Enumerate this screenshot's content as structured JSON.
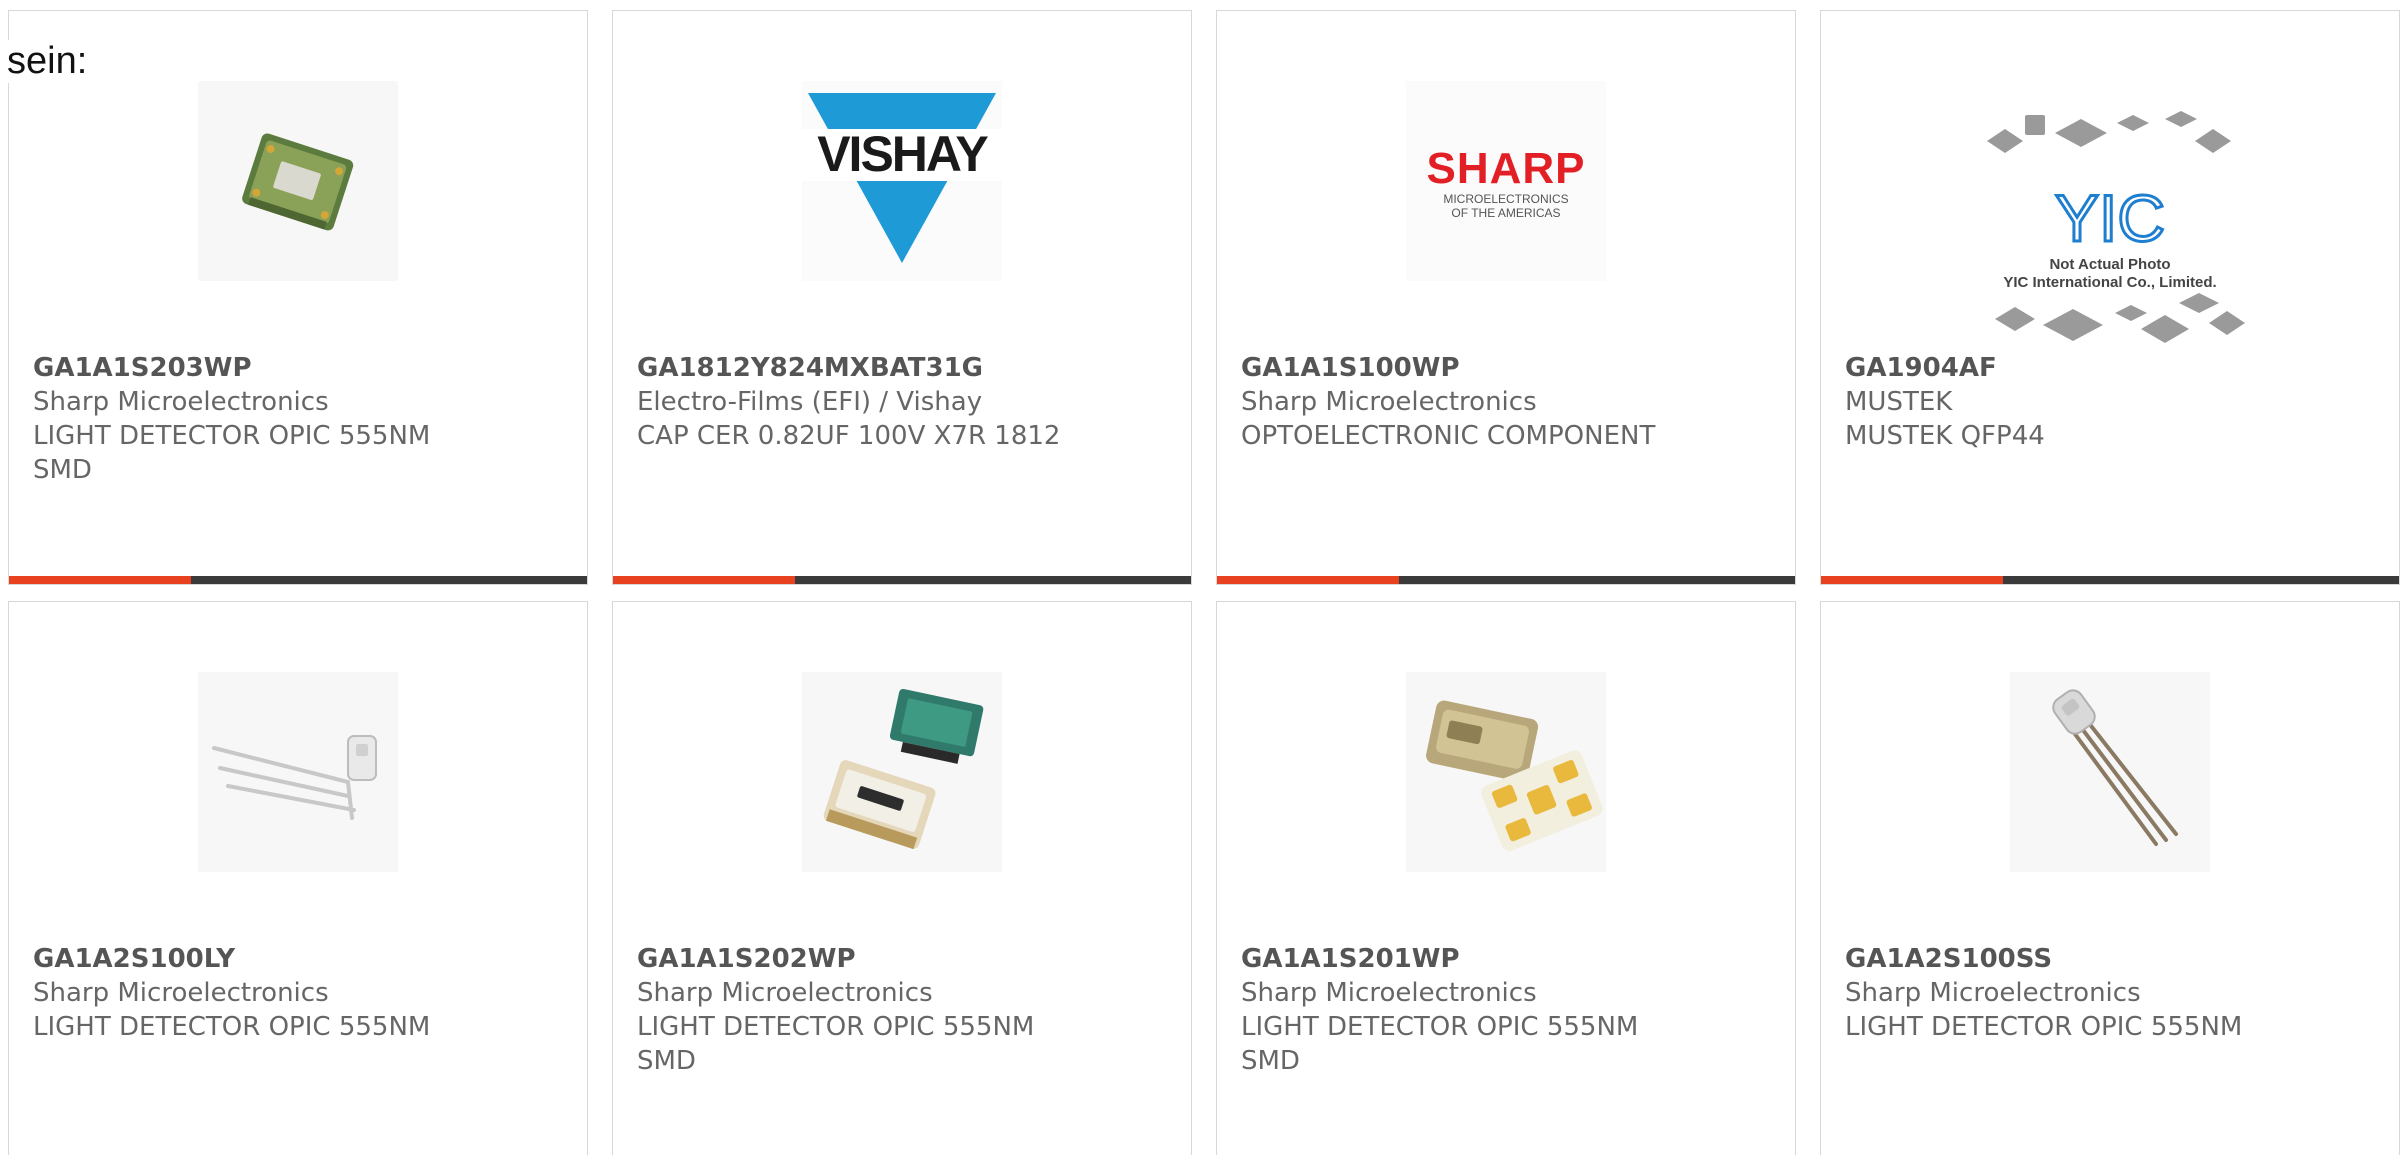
{
  "heading": "sein:",
  "colors": {
    "bar_accent": "#e8411f",
    "bar_dark": "#3a3a3a",
    "text": "#666666",
    "card_border": "#d8d8d8"
  },
  "products": [
    {
      "part_number": "GA1A1S203WP",
      "manufacturer": "Sharp Microelectronics",
      "description": [
        "LIGHT DETECTOR OPIC 555NM",
        "SMD"
      ],
      "image": "module-photo-icon",
      "has_bar": true
    },
    {
      "part_number": "GA1812Y824MXBAT31G",
      "manufacturer": "Electro-Films (EFI) / Vishay",
      "description": [
        "CAP CER 0.82UF 100V X7R 1812"
      ],
      "image": "vishay-logo",
      "logo_text": "VISHAY",
      "has_bar": true
    },
    {
      "part_number": "GA1A1S100WP",
      "manufacturer": "Sharp Microelectronics",
      "description": [
        "OPTOELECTRONIC COMPONENT"
      ],
      "image": "sharp-logo",
      "logo_text": "SHARP",
      "logo_sub": [
        "MICROELECTRONICS",
        "OF THE AMERICAS"
      ],
      "has_bar": true
    },
    {
      "part_number": "GA1904AF",
      "manufacturer": "MUSTEK",
      "description": [
        "MUSTEK QFP44"
      ],
      "image": "yic-placeholder",
      "logo_text": "YIC",
      "logo_sub": [
        "Not Actual Photo",
        "YIC International Co., Limited."
      ],
      "has_bar": true
    },
    {
      "part_number": "GA1A2S100LY",
      "manufacturer": "Sharp Microelectronics",
      "description": [
        "LIGHT DETECTOR OPIC 555NM"
      ],
      "image": "led-leads-photo-icon",
      "has_bar": false
    },
    {
      "part_number": "GA1A1S202WP",
      "manufacturer": "Sharp Microelectronics",
      "description": [
        "LIGHT DETECTOR OPIC 555NM",
        "SMD"
      ],
      "image": "sensor-modules-photo-icon",
      "has_bar": false
    },
    {
      "part_number": "GA1A1S201WP",
      "manufacturer": "Sharp Microelectronics",
      "description": [
        "LIGHT DETECTOR OPIC 555NM",
        "SMD"
      ],
      "image": "smd-package-photo-icon",
      "has_bar": false
    },
    {
      "part_number": "GA1A2S100SS",
      "manufacturer": "Sharp Microelectronics",
      "description": [
        "LIGHT DETECTOR OPIC 555NM"
      ],
      "image": "through-hole-sensor-photo-icon",
      "has_bar": false
    }
  ]
}
